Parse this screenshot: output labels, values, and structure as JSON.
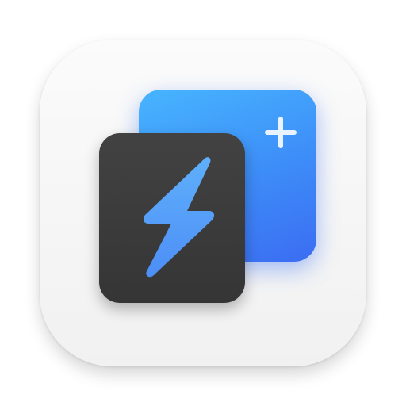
{
  "app_icon": {
    "name": "",
    "colors": {
      "base": "#f5f5f5",
      "blue_card_top": "#47b5fe",
      "blue_card_bottom": "#3b6df2",
      "dark_card": "#3a3a3a",
      "bolt": "#5aa4fb",
      "plus": "#e9f3ff"
    },
    "icons": {
      "front": "lightning-bolt-icon",
      "back": "plus-icon"
    }
  }
}
